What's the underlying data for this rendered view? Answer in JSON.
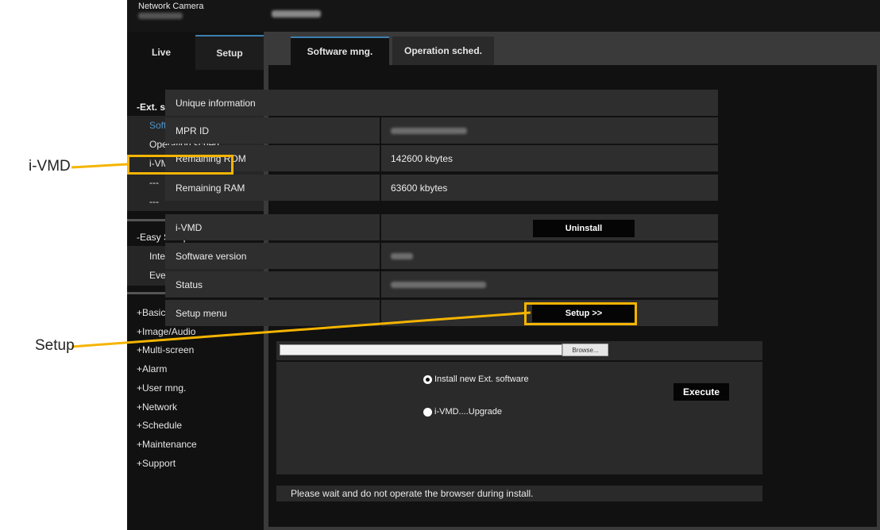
{
  "header": {
    "product": "Network Camera"
  },
  "nav": {
    "tabs": [
      {
        "label": "Live"
      },
      {
        "label": "Setup"
      }
    ],
    "ext_software": {
      "title": "-Ext. software",
      "items": [
        {
          "label": "Software mng.",
          "active": true
        },
        {
          "label": "Operation sched."
        },
        {
          "label": "i-VMD"
        },
        {
          "label": "---"
        },
        {
          "label": "---"
        }
      ]
    },
    "easy_setup": {
      "title": "-Easy Setup",
      "items": [
        {
          "label": "Internet"
        },
        {
          "label": "Event action"
        }
      ]
    },
    "groups": [
      "+Basic",
      "+Image/Audio",
      "+Multi-screen",
      "+Alarm",
      "+User mng.",
      "+Network",
      "+Schedule",
      "+Maintenance",
      "+Support"
    ]
  },
  "main": {
    "tabs": [
      {
        "label": "Software mng.",
        "active": true
      },
      {
        "label": "Operation sched."
      }
    ],
    "unique_info": {
      "title": "Unique information",
      "rows": [
        {
          "label": "MPR ID",
          "value": ""
        },
        {
          "label": "Remaining ROM",
          "value": "142600 kbytes"
        },
        {
          "label": "Remaining RAM",
          "value": "63600 kbytes"
        }
      ]
    },
    "software": {
      "rows": [
        {
          "label": "i-VMD"
        },
        {
          "label": "Software version"
        },
        {
          "label": "Status"
        },
        {
          "label": "Setup menu"
        }
      ],
      "uninstall_label": "Uninstall",
      "setup_label": "Setup >>"
    },
    "upload": {
      "browse_label": "Browse...",
      "file_value": "",
      "options": [
        {
          "label": "Install new Ext. software",
          "selected": true
        },
        {
          "label": "i-VMD....Upgrade",
          "selected": false
        }
      ],
      "execute_label": "Execute"
    },
    "note": "Please wait and do not operate the browser during install."
  },
  "annotations": {
    "ivmd_callout": "i-VMD",
    "setup_callout": "Setup",
    "highlight_color": "#f5b400"
  }
}
